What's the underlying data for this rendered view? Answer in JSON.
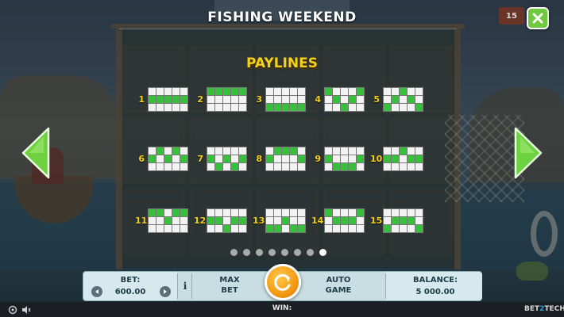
{
  "header": {
    "title": "FISHING WEEKEND",
    "lines_badge": "15"
  },
  "section_title": "PAYLINES",
  "paylines": [
    {
      "num": "1",
      "rows": [
        [
          0,
          0,
          0,
          0,
          0
        ],
        [
          1,
          1,
          1,
          1,
          1
        ],
        [
          0,
          0,
          0,
          0,
          0
        ]
      ]
    },
    {
      "num": "2",
      "rows": [
        [
          1,
          1,
          1,
          1,
          1
        ],
        [
          0,
          0,
          0,
          0,
          0
        ],
        [
          0,
          0,
          0,
          0,
          0
        ]
      ]
    },
    {
      "num": "3",
      "rows": [
        [
          0,
          0,
          0,
          0,
          0
        ],
        [
          0,
          0,
          0,
          0,
          0
        ],
        [
          1,
          1,
          1,
          1,
          1
        ]
      ]
    },
    {
      "num": "4",
      "rows": [
        [
          1,
          0,
          0,
          0,
          1
        ],
        [
          0,
          1,
          0,
          1,
          0
        ],
        [
          0,
          0,
          1,
          0,
          0
        ]
      ]
    },
    {
      "num": "5",
      "rows": [
        [
          0,
          0,
          1,
          0,
          0
        ],
        [
          0,
          1,
          0,
          1,
          0
        ],
        [
          1,
          0,
          0,
          0,
          1
        ]
      ]
    },
    {
      "num": "6",
      "rows": [
        [
          0,
          1,
          0,
          1,
          0
        ],
        [
          1,
          0,
          1,
          0,
          1
        ],
        [
          0,
          0,
          0,
          0,
          0
        ]
      ]
    },
    {
      "num": "7",
      "rows": [
        [
          0,
          0,
          0,
          0,
          0
        ],
        [
          1,
          0,
          1,
          0,
          1
        ],
        [
          0,
          1,
          0,
          1,
          0
        ]
      ]
    },
    {
      "num": "8",
      "rows": [
        [
          0,
          1,
          1,
          1,
          0
        ],
        [
          1,
          0,
          0,
          0,
          1
        ],
        [
          0,
          0,
          0,
          0,
          0
        ]
      ]
    },
    {
      "num": "9",
      "rows": [
        [
          0,
          0,
          0,
          0,
          0
        ],
        [
          1,
          0,
          0,
          0,
          1
        ],
        [
          0,
          1,
          1,
          1,
          0
        ]
      ]
    },
    {
      "num": "10",
      "rows": [
        [
          0,
          0,
          1,
          0,
          0
        ],
        [
          1,
          1,
          0,
          1,
          1
        ],
        [
          0,
          0,
          0,
          0,
          0
        ]
      ]
    },
    {
      "num": "11",
      "rows": [
        [
          1,
          1,
          0,
          1,
          1
        ],
        [
          0,
          0,
          1,
          0,
          0
        ],
        [
          0,
          0,
          0,
          0,
          0
        ]
      ]
    },
    {
      "num": "12",
      "rows": [
        [
          0,
          0,
          0,
          0,
          0
        ],
        [
          1,
          1,
          0,
          1,
          1
        ],
        [
          0,
          0,
          1,
          0,
          0
        ]
      ]
    },
    {
      "num": "13",
      "rows": [
        [
          0,
          0,
          0,
          0,
          0
        ],
        [
          0,
          0,
          1,
          0,
          0
        ],
        [
          1,
          1,
          0,
          1,
          1
        ]
      ]
    },
    {
      "num": "14",
      "rows": [
        [
          1,
          0,
          0,
          0,
          1
        ],
        [
          0,
          1,
          1,
          1,
          0
        ],
        [
          0,
          0,
          0,
          0,
          0
        ]
      ]
    },
    {
      "num": "15",
      "rows": [
        [
          0,
          0,
          0,
          0,
          0
        ],
        [
          0,
          1,
          1,
          1,
          0
        ],
        [
          1,
          0,
          0,
          0,
          1
        ]
      ]
    }
  ],
  "pagination": {
    "count": 8,
    "active_index": 7
  },
  "controls": {
    "bet_label": "BET:",
    "bet_value": "600.00",
    "info_label": "i",
    "max_bet_line1": "MAX",
    "max_bet_line2": "BET",
    "auto_game_line1": "AUTO",
    "auto_game_line2": "GAME",
    "balance_label": "BALANCE:",
    "balance_value": "5 000.00"
  },
  "footer": {
    "win_label": "WIN:",
    "brand_prefix": "BET",
    "brand_mid": "2",
    "brand_suffix": "TECH"
  },
  "colors": {
    "active_cell": "#35c23a",
    "title_yellow": "#f5d21a",
    "arrow_green": "#6ed13f",
    "panel": "#c8dee2"
  },
  "icons": [
    "close-icon",
    "arrow-left-icon",
    "arrow-right-icon",
    "spin-icon",
    "minus-icon",
    "plus-icon",
    "settings-icon",
    "sound-icon"
  ]
}
